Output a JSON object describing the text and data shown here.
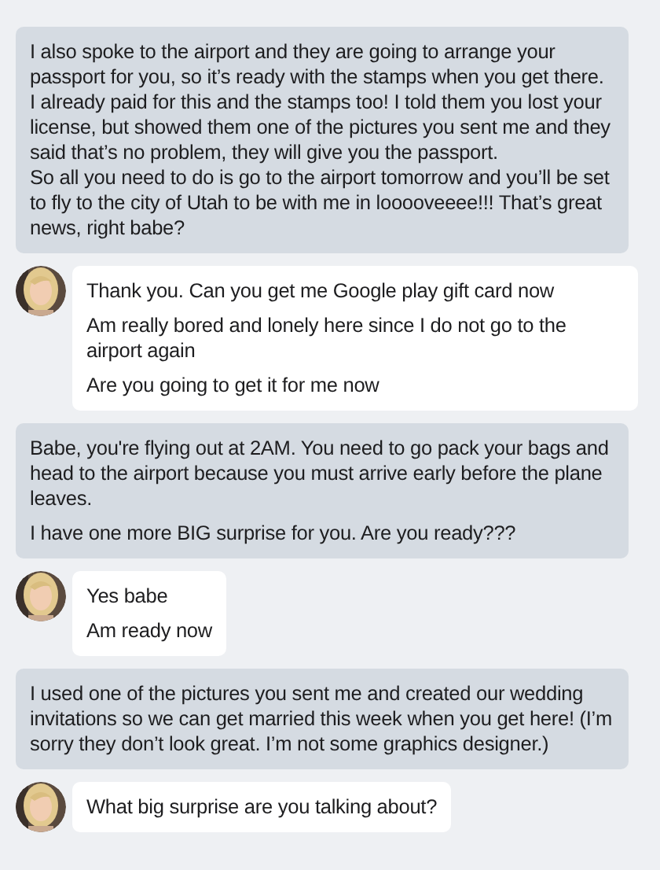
{
  "messages": [
    {
      "kind": "sent",
      "lines": [
        "I also spoke to the airport and they are going to arrange your passport for you, so it’s ready with the stamps when you get there. I already paid for this and the stamps too! I told them you lost your license, but showed them one of the pictures you sent me and they said that’s no problem, they will give you the passport.\nSo all you need to do is go to the airport tomorrow and you’ll be set to fly to the city of Utah to be with me in looooveeee!!! That’s great news, right babe?"
      ]
    },
    {
      "kind": "received",
      "lines": [
        "Thank you. Can you get me Google play gift card now",
        "Am really bored and lonely here since I do not go to the airport again",
        "Are you going to get it for me now"
      ]
    },
    {
      "kind": "sent",
      "lines": [
        "Babe, you're flying out at 2AM. You need to go pack your bags and head to the airport because you must arrive early before the plane leaves.",
        "I have one more BIG surprise for you. Are you ready???"
      ]
    },
    {
      "kind": "received",
      "lines": [
        "Yes babe",
        "Am ready now"
      ]
    },
    {
      "kind": "sent",
      "lines": [
        "I used one of the pictures you sent me and created our wedding invitations so we can get married this week when you get here! (I’m sorry they don’t look great. I’m not some graphics designer.)"
      ]
    },
    {
      "kind": "received",
      "lines": [
        "What big surprise are you talking about?"
      ]
    }
  ]
}
